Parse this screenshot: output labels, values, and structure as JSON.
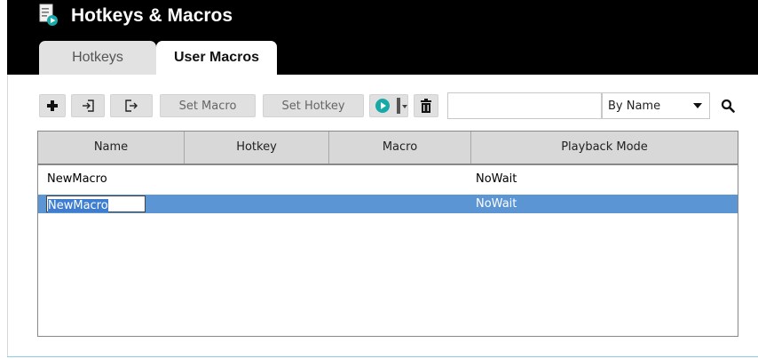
{
  "app": {
    "title": "Hotkeys & Macros"
  },
  "tabs": [
    {
      "label": "Hotkeys",
      "active": false
    },
    {
      "label": "User Macros",
      "active": true
    }
  ],
  "toolbar": {
    "add_icon": "plus-icon",
    "import_icon": "import-icon",
    "export_icon": "export-icon",
    "set_macro_label": "Set Macro",
    "set_hotkey_label": "Set Hotkey",
    "play_icon": "play-icon",
    "delete_icon": "trash-icon",
    "search_value": "",
    "sort_selected": "By Name",
    "search_icon": "magnifier-icon"
  },
  "table": {
    "columns": [
      "Name",
      "Hotkey",
      "Macro",
      "Playback Mode"
    ],
    "rows": [
      {
        "name": "NewMacro",
        "hotkey": "",
        "macro": "",
        "playback_mode": "NoWait",
        "selected": false
      },
      {
        "name": "NewMacro",
        "hotkey": "",
        "macro": "",
        "playback_mode": "NoWait",
        "selected": true,
        "editing": true
      }
    ]
  },
  "colors": {
    "header_bg": "#000000",
    "selection": "#5b95d4",
    "play_accent": "#17a8a8"
  }
}
